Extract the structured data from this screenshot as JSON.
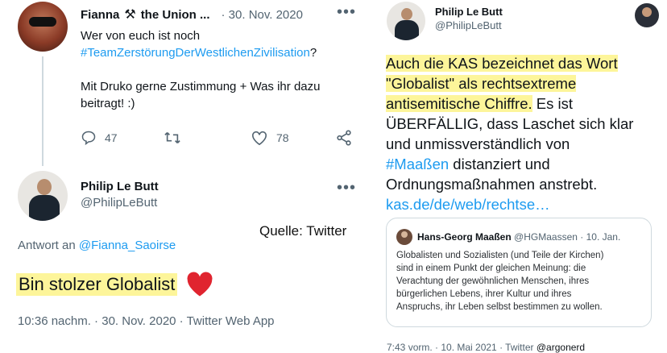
{
  "left": {
    "tweet1": {
      "author_name": "Fianna",
      "author_name_suffix": "the Union ...",
      "timestamp": "· 30. Nov. 2020",
      "text_line1": "Wer von euch ist noch",
      "hashtag": "#TeamZerstörungDerWestlichenZivilisation",
      "text_q": "?",
      "text_line3": "Mit Druko gerne Zustimmung + Was ihr dazu",
      "text_line4": "beitragt! :)",
      "replies": "47",
      "likes": "78"
    },
    "tweet2": {
      "author_name": "Philip Le Butt",
      "author_handle": "@PhilipLeButt",
      "source_label": "Quelle: Twitter",
      "reply_prefix": "Antwort an",
      "reply_to": "@Fianna_Saoirse",
      "text": "Bin stolzer Globalist",
      "meta": "10:36 nachm. · 30. Nov. 2020 · Twitter Web App"
    }
  },
  "right": {
    "tweet": {
      "author_name": "Philip Le Butt",
      "author_handle": "@PhilipLeButt",
      "hl_line1": "Auch die KAS bezeichnet das Wort",
      "hl_line2": "\"Globalist\" als rechtsextreme",
      "hl_line3": "antisemitische Chiffre.",
      "line3_rest": " Es ist",
      "line4": "ÜBERFÄLLIG, dass Laschet sich klar",
      "line5": "und unmissverständlich von",
      "hashtag": "#Maaßen",
      "line6_rest": " distanziert und",
      "line7": "Ordnungsmaßnahmen anstrebt.",
      "link": "kas.de/de/web/rechtse…",
      "meta_prefix": "7:43 vorm. · 10. Mai 2021 · Twitter",
      "meta_user": "@argonerd"
    },
    "quoted": {
      "author_name": "Hans-Georg Maaßen",
      "author_handle": "@HGMaassen",
      "date": "· 10. Jan.",
      "lines": [
        "Globalisten und Sozialisten (und Teile der Kirchen)",
        "sind in einem Punkt der gleichen Meinung: die",
        "Verachtung der gewöhnlichen Menschen, ihres",
        "bürgerlichen Lebens, ihrer Kultur und ihres",
        "Anspruchs, ihr Leben selbst bestimmen zu wollen."
      ]
    }
  }
}
